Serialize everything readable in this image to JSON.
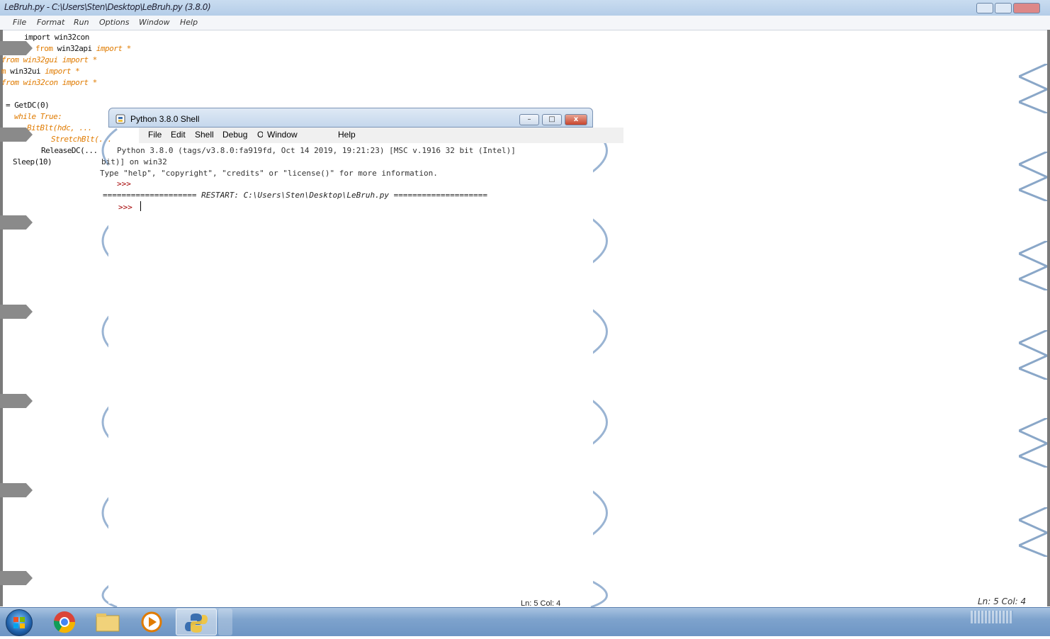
{
  "editor": {
    "title": "LeBruh.py - C:\\Users\\Sten\\Desktop\\LeBruh.py (3.8.0)",
    "menu": [
      "File",
      "Format",
      "Run",
      "Options",
      "Window",
      "Help"
    ],
    "code_lines": [
      {
        "kw": "",
        "rest": "import win32con",
        "str": ""
      },
      {
        "kw": "from",
        "rest": " win32api ",
        "str": "import *"
      },
      {
        "kw": "",
        "rest": "",
        "str": "from win32gui import *"
      },
      {
        "kw": "m",
        "rest": " win32ui ",
        "str": "import *"
      },
      {
        "kw": "",
        "rest": "",
        "str": "from win32con import *"
      },
      {
        "kw": "",
        "rest": "= GetDC(0)",
        "str": ""
      },
      {
        "kw": "",
        "rest": "",
        "str": "while True:"
      },
      {
        "kw": "",
        "rest": "",
        "str": "BitBlt(hdc, ..."
      },
      {
        "kw": "",
        "rest": "",
        "str": "StretchBlt(..."
      },
      {
        "kw": "",
        "rest": "ReleaseDC(...",
        "str": ""
      },
      {
        "kw": "",
        "rest": "Sleep(10)",
        "str": ""
      }
    ],
    "status": "Ln: 5  Col: 4"
  },
  "shell": {
    "title": "Python 3.8.0 Shell",
    "menu": [
      "File",
      "Edit",
      "Shell",
      "Debug",
      "Options",
      "Window",
      "Help"
    ],
    "lines": [
      "Python 3.8.0 (tags/v3.8.0:fa919fd, Oct 14 2019, 19:21:23) [MSC v.1916 32 bit (Intel)]",
      "bit)] on win32",
      "Type \"help\", \"copyright\", \"credits\" or \"license()\" for more information.",
      ">>>"
    ],
    "restart_line": "==================== RESTART: C:\\Users\\Sten\\Desktop\\LeBruh.py ====================",
    "prompt": ">>>",
    "status": "Ln: 5  Col: 4",
    "buttons": {
      "minimize": "–",
      "maximize": "□",
      "close": "x"
    }
  },
  "taskbar": {
    "apps": [
      "start-orb",
      "chrome",
      "file-explorer",
      "media-player",
      "python-idle"
    ]
  },
  "colors": {
    "keyword": "#e07b00",
    "prompt": "#a40000",
    "taskbar": "#7ea3cd"
  }
}
